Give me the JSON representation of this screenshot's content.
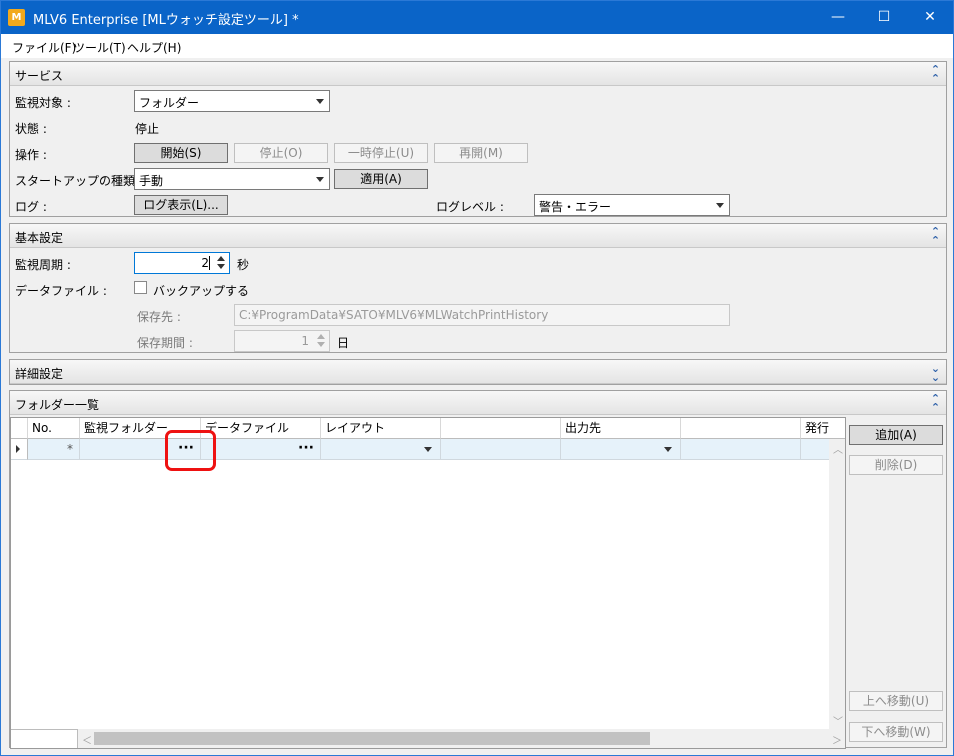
{
  "window": {
    "logo": "M",
    "title": "MLV6 Enterprise [MLウォッチ設定ツール] *",
    "minimize": "—",
    "maximize": "☐",
    "close": "✕"
  },
  "menu": [
    "ファイル(F)",
    "ツール(T)",
    "ヘルプ(H)"
  ],
  "service": {
    "title": "サービス",
    "monitor_target_label": "監視対象 :",
    "monitor_target_value": "フォルダー",
    "status_label": "状態 :",
    "status_value": "停止",
    "operation_label": "操作 :",
    "start_button": "開始(S)",
    "stop_button": "停止(O)",
    "pause_button": "一時停止(U)",
    "resume_button": "再開(M)",
    "startup_type_label": "スタートアップの種類 :",
    "startup_type_value": "手動",
    "apply_button": "適用(A)",
    "log_label": "ログ :",
    "log_view_button": "ログ表示(L)...",
    "log_level_label": "ログレベル :",
    "log_level_value": "警告・エラー"
  },
  "basic": {
    "title": "基本設定",
    "interval_label": "監視周期 :",
    "interval_value": "2",
    "interval_unit": "秒",
    "datafile_label": "データファイル :",
    "backup_label": "バックアップする",
    "save_to_label": "保存先 :",
    "save_to_value": "C:¥ProgramData¥SATO¥MLV6¥MLWatchPrintHistory",
    "save_period_label": "保存期間 :",
    "save_period_value": "1",
    "save_period_unit": "日"
  },
  "detail": {
    "title": "詳細設定"
  },
  "folder_list": {
    "title": "フォルダー一覧",
    "columns": [
      "No.",
      "監視フォルダー",
      "データファイル",
      "レイアウト",
      "",
      "出力先",
      "",
      "発行"
    ],
    "new_row_marker": "*",
    "browse_dots": "···",
    "add_button": "追加(A)",
    "delete_button": "削除(D)",
    "move_up_button": "上へ移動(U)",
    "move_down_button": "下へ移動(W)"
  }
}
